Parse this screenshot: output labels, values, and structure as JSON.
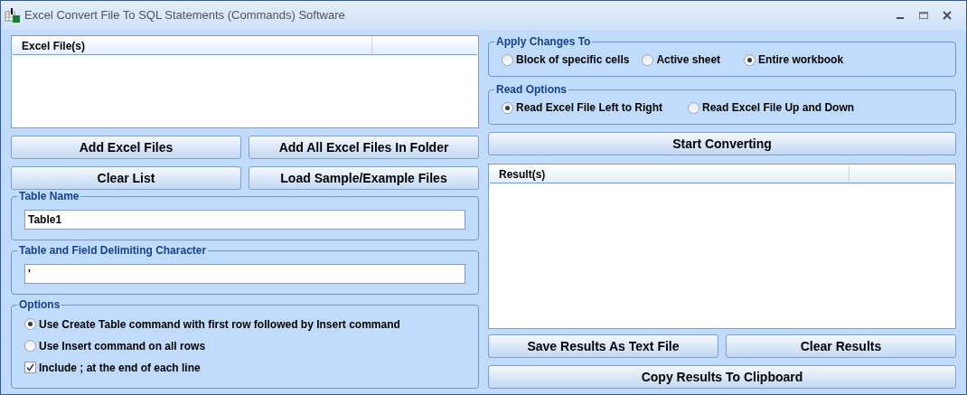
{
  "window": {
    "title": "Excel Convert File To SQL Statements (Commands) Software"
  },
  "files_list": {
    "columns": [
      "Excel File(s)"
    ]
  },
  "file_buttons": [
    "Add Excel Files",
    "Add All Excel Files In Folder",
    "Clear List",
    "Load Sample/Example Files"
  ],
  "table_name": {
    "label": "Table Name",
    "value": "Table1"
  },
  "delimiter": {
    "label": "Table and Field Delimiting Character",
    "value": "'"
  },
  "options": {
    "label": "Options",
    "items": [
      {
        "kind": "radio",
        "label": "Use Create Table command with first row followed by Insert command",
        "selected": true
      },
      {
        "kind": "radio",
        "label": "Use Insert command on all rows",
        "selected": false
      },
      {
        "kind": "checkbox",
        "label": "Include ; at the end of each line",
        "checked": true
      }
    ]
  },
  "apply_changes": {
    "label": "Apply Changes To",
    "options": [
      {
        "label": "Block of specific cells",
        "selected": false
      },
      {
        "label": "Active sheet",
        "selected": false
      },
      {
        "label": "Entire workbook",
        "selected": true
      }
    ]
  },
  "read_options": {
    "label": "Read Options",
    "options": [
      {
        "label": "Read Excel File Left to Right",
        "selected": true
      },
      {
        "label": "Read Excel File Up and Down",
        "selected": false
      }
    ]
  },
  "start_button": "Start Converting",
  "results_list": {
    "columns": [
      "Result(s)"
    ]
  },
  "result_buttons": [
    "Save Results As Text File",
    "Clear Results"
  ],
  "copy_button": "Copy Results To Clipboard"
}
